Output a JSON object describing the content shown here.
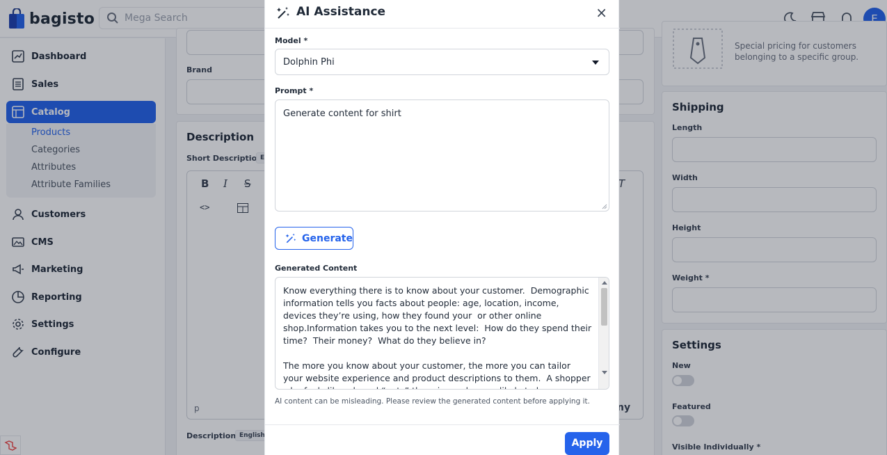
{
  "header": {
    "brand": "bagisto",
    "search_placeholder": "Mega Search",
    "avatar_initial": "E"
  },
  "sidebar": {
    "items": [
      {
        "label": "Dashboard",
        "icon": "dashboard-icon"
      },
      {
        "label": "Sales",
        "icon": "sales-icon"
      },
      {
        "label": "Catalog",
        "icon": "catalog-icon"
      },
      {
        "label": "Customers",
        "icon": "customers-icon"
      },
      {
        "label": "CMS",
        "icon": "cms-icon"
      },
      {
        "label": "Marketing",
        "icon": "marketing-icon"
      },
      {
        "label": "Reporting",
        "icon": "reporting-icon"
      },
      {
        "label": "Settings",
        "icon": "settings-icon"
      },
      {
        "label": "Configure",
        "icon": "configure-icon"
      }
    ],
    "catalog_sub": [
      "Products",
      "Categories",
      "Attributes",
      "Attribute Families"
    ]
  },
  "main": {
    "brand_label": "Brand",
    "description_title": "Description",
    "short_description_label": "Short Description *",
    "description_label": "Description *",
    "description_lang_badge": "English",
    "short_desc_lang_badge_fragment": "E",
    "editor_footer_p": "p",
    "editor_fragment": "ny",
    "customer_group_text": "Special pricing for customers belonging to a specific group.",
    "shipping": {
      "title": "Shipping",
      "length": "Length",
      "width": "Width",
      "height": "Height",
      "weight": "Weight *"
    },
    "settings": {
      "title": "Settings",
      "new": "New",
      "featured": "Featured",
      "visible": "Visible Individually *"
    }
  },
  "modal": {
    "title": "AI Assistance",
    "model_label": "Model *",
    "model_value": "Dolphin Phi",
    "prompt_label": "Prompt *",
    "prompt_value": "Generate content for shirt",
    "generate_label": "Generate",
    "generated_label": "Generated Content",
    "generated_text": "Know everything there is to know about your customer.  Demographic information tells you facts about people: age, location, income, devices they’re using, how they found your  or other online shop.Information takes you to the next level:  How do they spend their time?  Their money?  What do they believe in?\n\nThe more you know about your customer, the more you can tailor your website experience and product descriptions to them.  A shopper who feels like a brand “gets” them is much more likely to become a repeat customer.",
    "disclaimer": "AI content can be misleading. Please review the generated content before applying it.",
    "apply_label": "Apply",
    "close_glyph": "×"
  },
  "colors": {
    "primary": "#2563eb",
    "overlay": "rgba(17,24,39,0.3)"
  }
}
